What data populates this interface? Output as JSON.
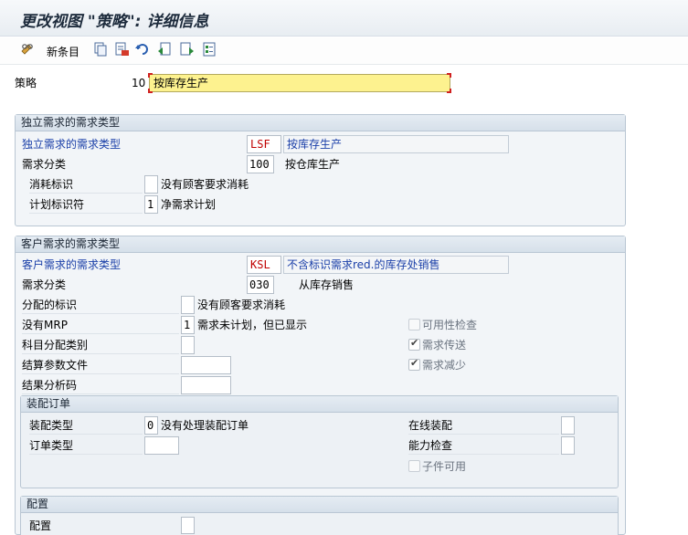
{
  "window": {
    "title": "更改视图 \"策略\": 详细信息"
  },
  "toolbar": {
    "new_entries_label": "新条目"
  },
  "policy": {
    "label": "策略",
    "code": "10",
    "description": "按库存生产"
  },
  "independent_group": {
    "title": "独立需求的需求类型",
    "req_type_label": "独立需求的需求类型",
    "req_type_code": "LSF",
    "req_type_text": "按库存生产",
    "req_class_label": "需求分类",
    "req_class_code": "100",
    "req_class_text": "按仓库生产",
    "consume_label": "消耗标识",
    "consume_text": "没有顾客要求消耗",
    "plan_ind_label": "计划标识符",
    "plan_ind_value": "1",
    "plan_ind_text": "净需求计划"
  },
  "customer_group": {
    "title": "客户需求的需求类型",
    "req_type_label": "客户需求的需求类型",
    "req_type_code": "KSL",
    "req_type_text": "不含标识需求red.的库存处销售",
    "req_class_label": "需求分类",
    "req_class_code": "030",
    "req_class_text": "从库存销售",
    "alloc_label": "分配的标识",
    "alloc_text": "没有顾客要求消耗",
    "no_mrp_label": "没有MRP",
    "no_mrp_value": "1",
    "no_mrp_text": "需求未计划，但已显示",
    "acct_label": "科目分配类别",
    "settle_label": "结算参数文件",
    "result_label": "结果分析码",
    "avail_check_label": "可用性检查",
    "req_transfer_label": "需求传送",
    "req_reduce_label": "需求减少"
  },
  "assembly_group": {
    "title": "装配订单",
    "asm_type_label": "装配类型",
    "asm_type_value": "0",
    "asm_type_text": "没有处理装配订单",
    "order_type_label": "订单类型",
    "online_asm_label": "在线装配",
    "capacity_label": "能力检查",
    "components_label": "子件可用"
  },
  "config_group": {
    "title": "配置",
    "config_label": "配置"
  }
}
